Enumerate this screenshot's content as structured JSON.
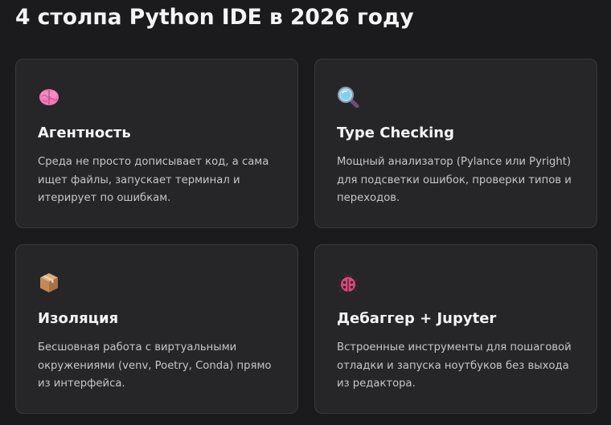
{
  "page": {
    "title": "4 столпа Python IDE в 2026 году"
  },
  "cards": [
    {
      "icon": "brain-icon",
      "title": "Агентность",
      "text": "Среда не просто дописывает код, а сама ищет файлы, запускает терминал и итерирует по ошибкам."
    },
    {
      "icon": "magnifying-glass-icon",
      "title": "Type Checking",
      "text": "Мощный анализатор (Pylance или Pyright) для подсветки ошибок, проверки типов и переходов."
    },
    {
      "icon": "package-box-icon",
      "title": "Изоляция",
      "text": "Бесшовная работа с виртуальными окружениями (venv, Poetry, Conda) прямо из интерфейса."
    },
    {
      "icon": "lady-beetle-icon",
      "title": "Дебаггер + Jupyter",
      "text": "Встроенные инструменты для пошаговой отладки и запуска ноутбуков без выхода из редактора."
    }
  ],
  "colors": {
    "background": "#1b1b1d",
    "card": "#262628",
    "card_border": "#39393c",
    "heading": "#f4f4f4",
    "body_text": "#c6c6c9"
  }
}
